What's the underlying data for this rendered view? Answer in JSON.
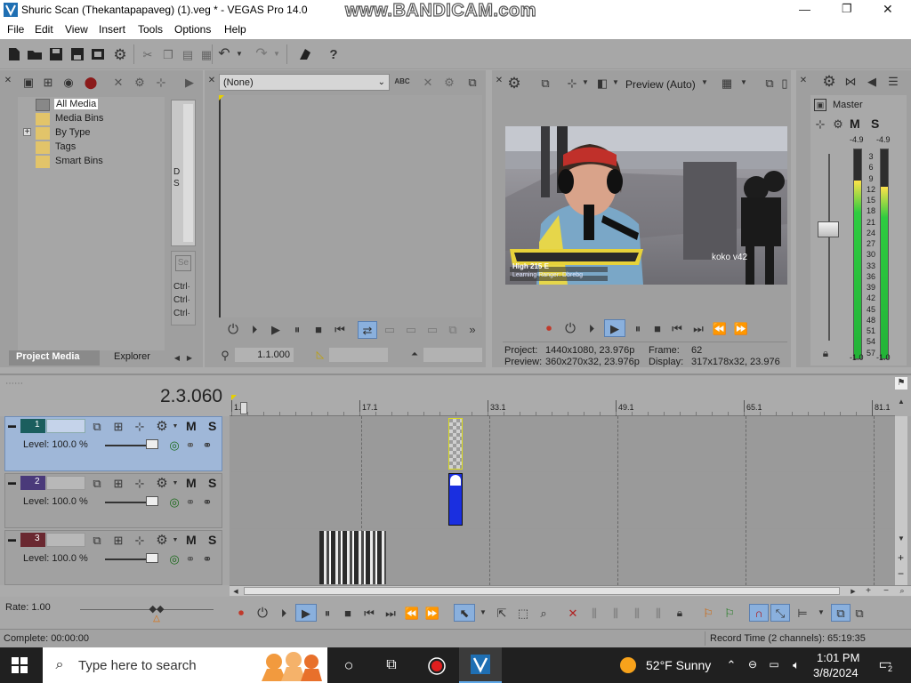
{
  "window": {
    "title": "Shuric Scan (Thekantapapaveg) (1).veg * - VEGAS Pro 14.0",
    "watermark": "www.BANDICAM.com",
    "controls": {
      "minimize": "—",
      "maximize": "❐",
      "close": "✕"
    }
  },
  "menu": [
    "File",
    "Edit",
    "View",
    "Insert",
    "Tools",
    "Options",
    "Help"
  ],
  "project_media": {
    "tree": [
      "All Media",
      "Media Bins",
      "By Type",
      "Tags",
      "Smart Bins"
    ],
    "expander": "+",
    "side_text": [
      "D",
      "S",
      "Ctrl·",
      "Ctrl·",
      "Ctrl·"
    ],
    "tabs": [
      "Project Media",
      "Explorer"
    ]
  },
  "trimmer": {
    "dropdown_value": "(None)",
    "timecode": "1.1.000"
  },
  "preview": {
    "mode": "Preview (Auto)",
    "overlay_name": "koko v42",
    "overlay_line1": "High 215 E",
    "overlay_line2": "Learning Ranger: Dbrebg",
    "project_label": "Project:",
    "project_value": "1440x1080, 23.976p",
    "preview_label": "Preview:",
    "preview_value": "360x270x32, 23.976p",
    "frame_label": "Frame:",
    "frame_value": "62",
    "display_label": "Display:",
    "display_value": "317x178x32, 23.976"
  },
  "master": {
    "title": "Master",
    "m": "M",
    "s": "S",
    "peak_left": "-4.9",
    "peak_right": "-4.9",
    "scale": [
      "3",
      "6",
      "9",
      "12",
      "15",
      "18",
      "21",
      "24",
      "27",
      "30",
      "33",
      "36",
      "39",
      "42",
      "45",
      "48",
      "51",
      "54",
      "57"
    ],
    "bottom_left": "-1.0",
    "bottom_right": "-1.0"
  },
  "timeline": {
    "timecode": "2.3.060",
    "ruler": [
      "1.1",
      "17.1",
      "33.1",
      "49.1",
      "65.1",
      "81.1"
    ],
    "tracks": [
      {
        "num": "1",
        "level": "Level: 100.0 %",
        "m": "M",
        "s": "S"
      },
      {
        "num": "2",
        "level": "Level: 100.0 %",
        "m": "M",
        "s": "S"
      },
      {
        "num": "3",
        "level": "Level: 100.0 %",
        "m": "M",
        "s": "S"
      }
    ],
    "zoom_plus": "+",
    "zoom_minus": "−"
  },
  "transport": {
    "rate": "Rate: 1.00"
  },
  "status": {
    "left": "Complete: 00:00:00",
    "right": "Record Time (2 channels): 65:19:35"
  },
  "taskbar": {
    "search_placeholder": "Type here to search",
    "weather": "52°F  Sunny",
    "time": "1:01 PM",
    "date": "3/8/2024",
    "notif_count": "2"
  },
  "colors": {
    "track1": "#1b5e5e",
    "track2": "#4a3a7a",
    "track3": "#6a2830",
    "selected_track": "#9fb7d8",
    "audio_clip": "#1a2fe0",
    "meter_green": "#2ecc40",
    "accent_blue": "#0078d7"
  }
}
